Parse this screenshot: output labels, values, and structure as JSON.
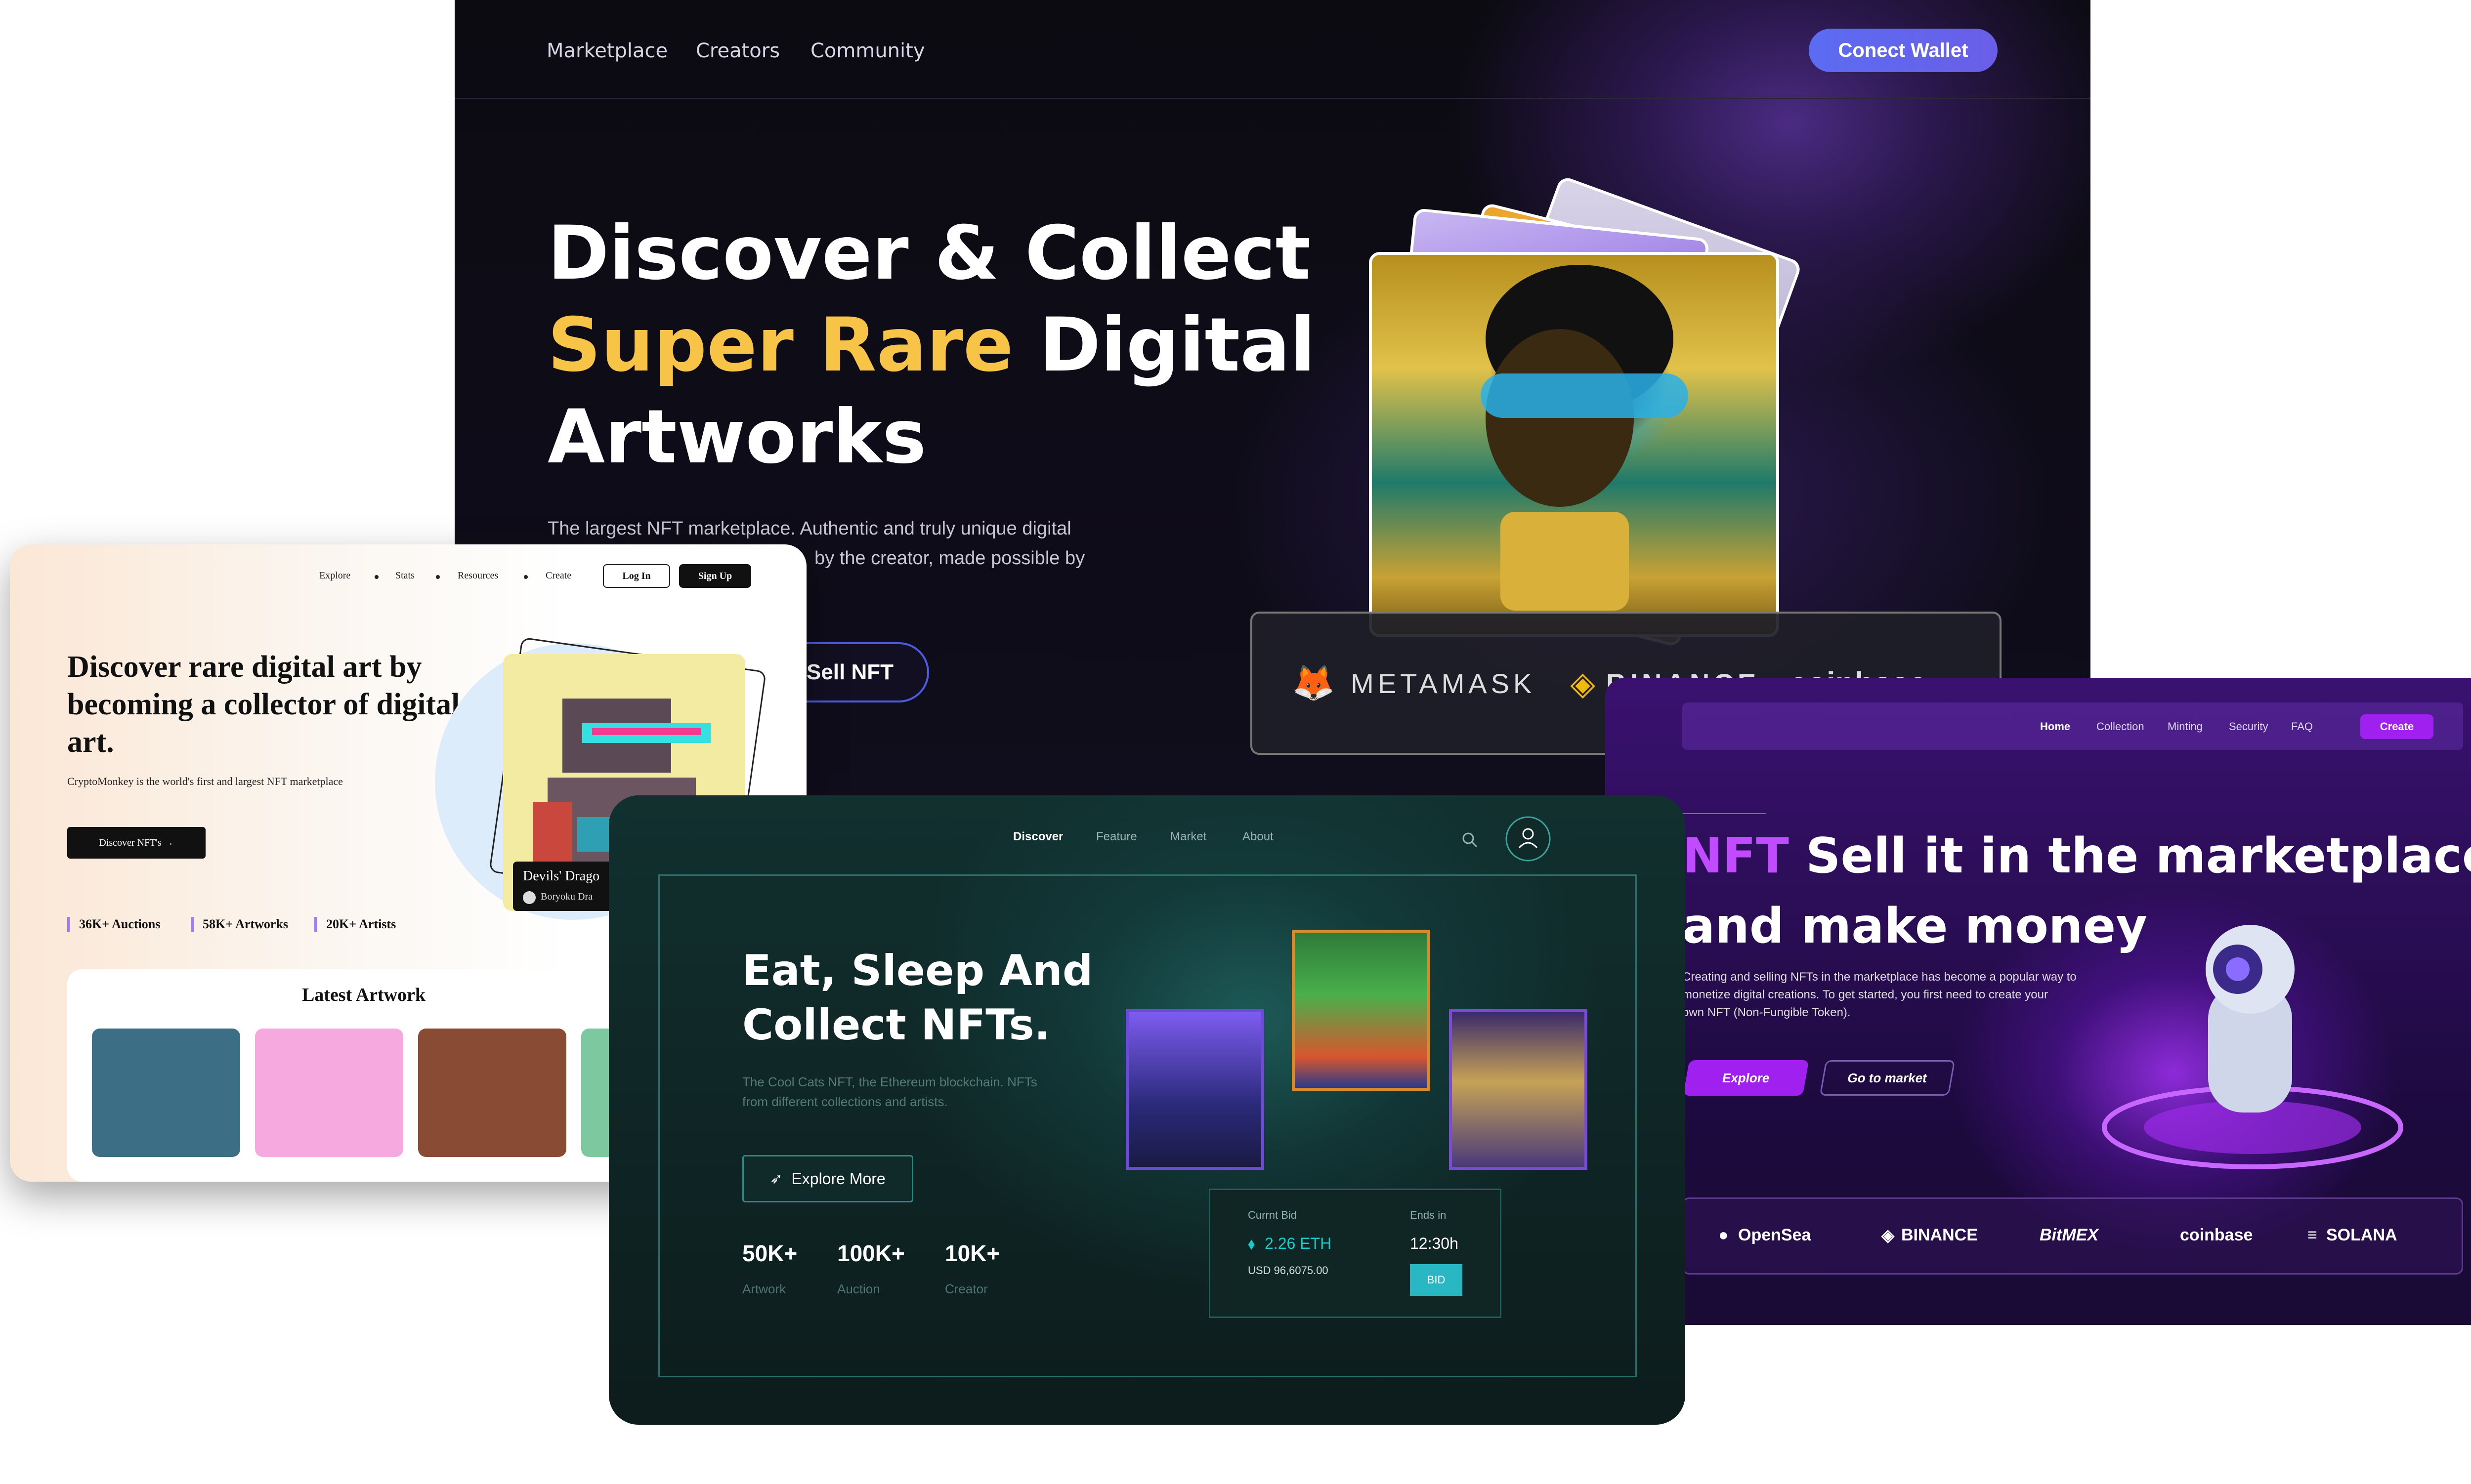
{
  "hero": {
    "nav": [
      "Marketplace",
      "Creators",
      "Community"
    ],
    "connect_label": "Conect Wallet",
    "title_line1": "Discover & Collect",
    "title_highlight": "Super Rare",
    "title_line2_rest": " Digital",
    "title_line3": "Artworks",
    "subtitle_line1": "The largest NFT marketplace. Authentic and truly unique digital",
    "subtitle_line2": "by the creator, made possible by",
    "sell_label": "Sell NFT",
    "wallets": [
      "METAMASK",
      "BINANCE",
      "coinbase"
    ],
    "colors": {
      "highlight": "#f7c447",
      "button": "#5b6cf2"
    }
  },
  "light": {
    "nav": [
      "Explore",
      "Stats",
      "Resources",
      "Create"
    ],
    "login_label": "Log In",
    "signup_label": "Sign Up",
    "title": "Discover rare digital art by becoming a collector of digital art.",
    "subtitle": "CryptoMonkey is the world's first and largest NFT marketplace",
    "cta_label": "Discover NFT's →",
    "stats": [
      "36K+ Auctions",
      "58K+ Artworks",
      "20K+ Artists"
    ],
    "card_title": "Devils' Drago",
    "card_owner": "Boryoku Dra",
    "latest_title": "Latest Artwork"
  },
  "teal": {
    "nav": [
      "Discover",
      "Feature",
      "Market",
      "About"
    ],
    "title_line1": "Eat, Sleep And",
    "title_line2": "Collect NFTs.",
    "subtitle_line1": "The Cool Cats NFT, the Ethereum blockchain.  NFTs",
    "subtitle_line2": "from different collections and artists.",
    "explore_label": "Explore More",
    "stats": [
      {
        "value": "50K+",
        "label": "Artwork"
      },
      {
        "value": "100K+",
        "label": "Auction"
      },
      {
        "value": "10K+",
        "label": "Creator"
      }
    ],
    "bid": {
      "current_label": "Currnt Bid",
      "eth": "2.26  ETH",
      "usd": "USD  96,6075.00",
      "ends_label": "Ends in",
      "time": "12:30h",
      "button": "BID"
    }
  },
  "purple": {
    "nav": [
      "Home",
      "Collection",
      "Minting",
      "Security",
      "FAQ"
    ],
    "create_label": "Create",
    "title_nft": "NFT",
    "title_line1_rest": " Sell it in the marketplace",
    "title_line2": "and make money",
    "subtitle_line1": "Creating and selling NFTs in the marketplace has become a popular way to",
    "subtitle_line2": "monetize digital creations. To get started, you first need to create your",
    "subtitle_line3": "own NFT (Non-Fungible Token).",
    "explore_label": "Explore",
    "market_label": "Go to market",
    "partners": [
      "OpenSea",
      "BINANCE",
      "BitMEX",
      "coinbase",
      "SOLANA"
    ]
  }
}
